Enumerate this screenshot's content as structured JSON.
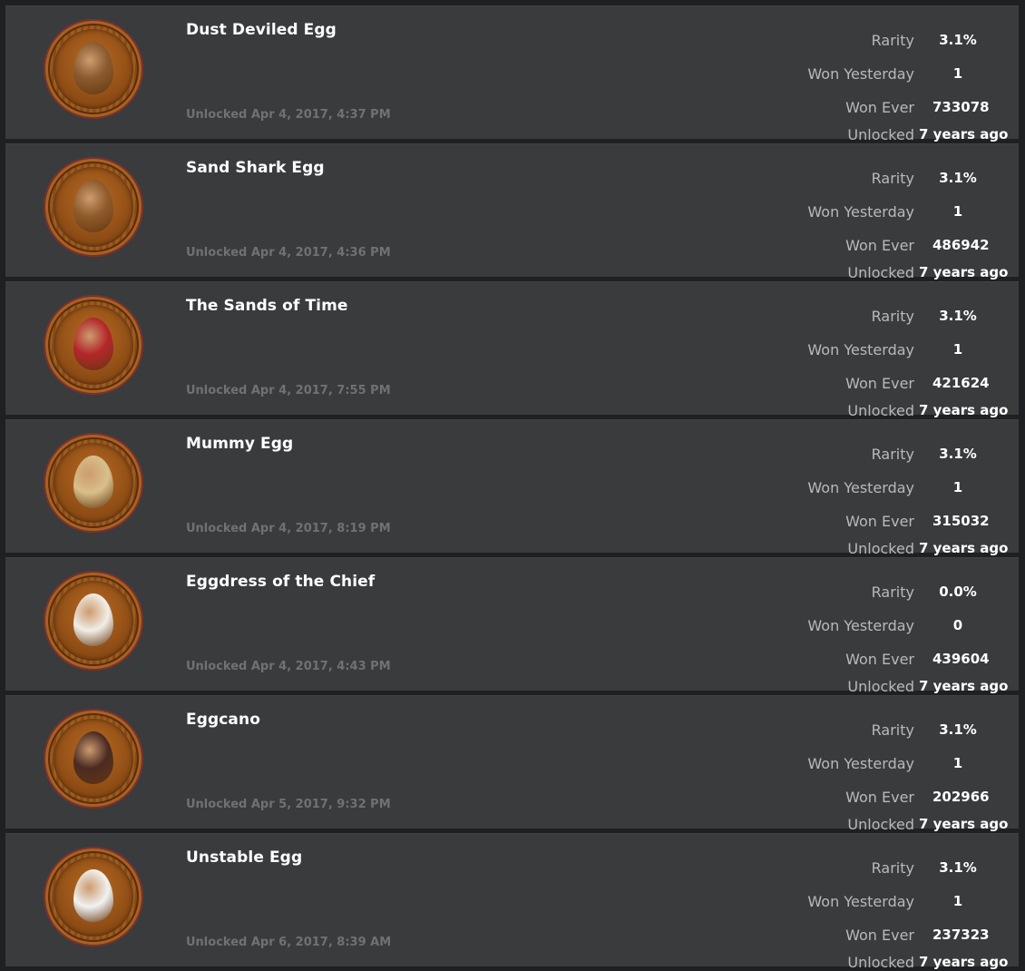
{
  "labels": {
    "rarity": "Rarity",
    "won_yesterday": "Won Yesterday",
    "won_ever": "Won Ever",
    "unlocked": "Unlocked"
  },
  "badges": [
    {
      "title": "Dust Deviled Egg",
      "unlocked_date": "Unlocked Apr 4, 2017, 4:37 PM",
      "rarity": "3.1%",
      "won_yesterday": "1",
      "won_ever": "733078",
      "unlocked_ago": "7 years ago",
      "icon": "dust-deviled-egg-icon",
      "egg_color": "#8a5a2e"
    },
    {
      "title": "Sand Shark Egg",
      "unlocked_date": "Unlocked Apr 4, 2017, 4:36 PM",
      "rarity": "3.1%",
      "won_yesterday": "1",
      "won_ever": "486942",
      "unlocked_ago": "7 years ago",
      "icon": "sand-shark-egg-icon",
      "egg_color": "#8f5a2a"
    },
    {
      "title": "The Sands of Time",
      "unlocked_date": "Unlocked Apr 4, 2017, 7:55 PM",
      "rarity": "3.1%",
      "won_yesterday": "1",
      "won_ever": "421624",
      "unlocked_ago": "7 years ago",
      "icon": "hourglass-egg-icon",
      "egg_color": "#b3262a"
    },
    {
      "title": "Mummy Egg",
      "unlocked_date": "Unlocked Apr 4, 2017, 8:19 PM",
      "rarity": "3.1%",
      "won_yesterday": "1",
      "won_ever": "315032",
      "unlocked_ago": "7 years ago",
      "icon": "mummy-egg-icon",
      "egg_color": "#d9c08a"
    },
    {
      "title": "Eggdress of the Chief",
      "unlocked_date": "Unlocked Apr 4, 2017, 4:43 PM",
      "rarity": "0.0%",
      "won_yesterday": "0",
      "won_ever": "439604",
      "unlocked_ago": "7 years ago",
      "icon": "chief-headdress-egg-icon",
      "egg_color": "#f2eee6"
    },
    {
      "title": "Eggcano",
      "unlocked_date": "Unlocked Apr 5, 2017, 9:32 PM",
      "rarity": "3.1%",
      "won_yesterday": "1",
      "won_ever": "202966",
      "unlocked_ago": "7 years ago",
      "icon": "volcano-egg-icon",
      "egg_color": "#4a2a22"
    },
    {
      "title": "Unstable Egg",
      "unlocked_date": "Unlocked Apr 6, 2017, 8:39 AM",
      "rarity": "3.1%",
      "won_yesterday": "1",
      "won_ever": "237323",
      "unlocked_ago": "7 years ago",
      "icon": "angry-egg-icon",
      "egg_color": "#f2f2f2"
    }
  ]
}
